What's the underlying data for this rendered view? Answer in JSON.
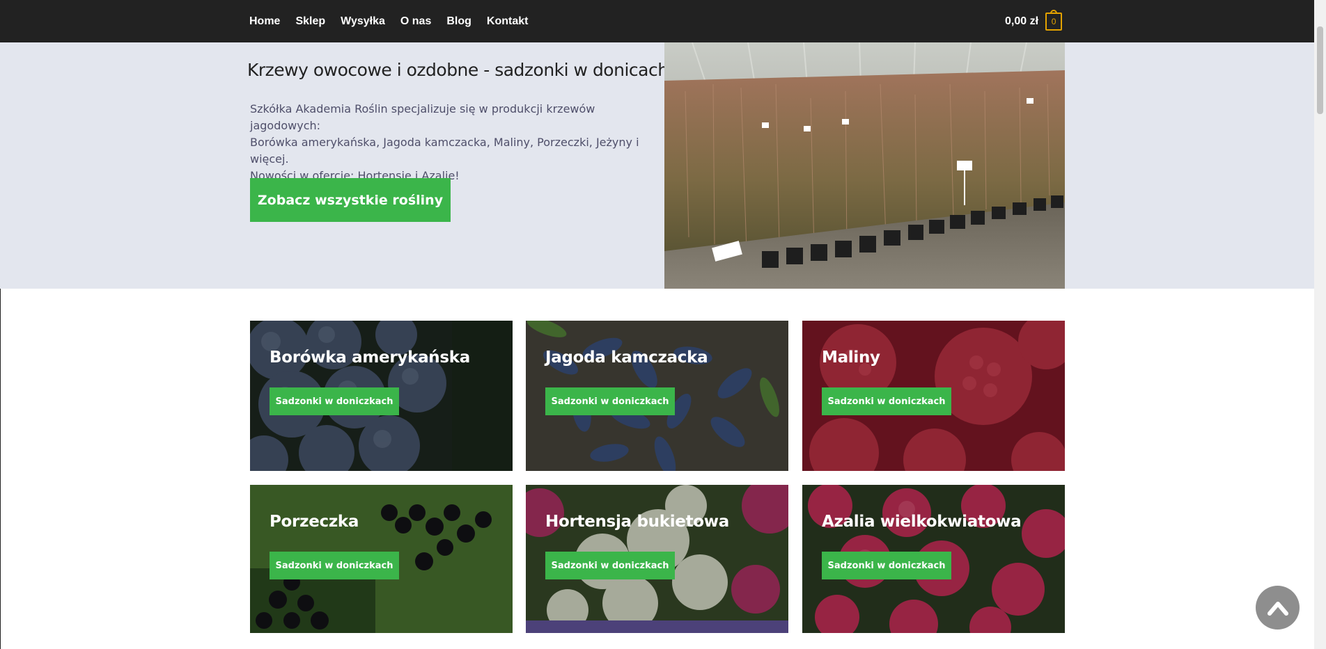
{
  "nav": {
    "items": [
      "Home",
      "Sklep",
      "Wysyłka",
      "O nas",
      "Blog",
      "Kontakt"
    ],
    "cart_total": "0,00 zł",
    "cart_count": "0"
  },
  "hero": {
    "title": "Krzewy owocowe i ozdobne - sadzonki w donicach",
    "text_lines": [
      "Szkółka Akademia Roślin specjalizuje się w produkcji krzewów jagodowych:",
      "Borówka amerykańska, Jagoda kamczacka, Maliny, Porzeczki, Jeżyny i więcej.",
      "Nowości w ofercie: Hortensje i Azalie!"
    ],
    "button": "Zobacz wszystkie rośliny"
  },
  "tiles": [
    {
      "title": "Borówka amerykańska",
      "button": "Sadzonki w doniczkach"
    },
    {
      "title": "Jagoda kamczacka",
      "button": "Sadzonki w doniczkach"
    },
    {
      "title": "Maliny",
      "button": "Sadzonki w doniczkach"
    },
    {
      "title": "Porzeczka",
      "button": "Sadzonki w doniczkach"
    },
    {
      "title": "Hortensja bukietowa",
      "button": "Sadzonki w doniczkach"
    },
    {
      "title": "Azalia wielkokwiatowa",
      "button": "Sadzonki w doniczkach"
    }
  ],
  "colors": {
    "topbar": "#222222",
    "hero_bg": "#e3e6ee",
    "accent_green": "#3bb54a",
    "cart_badge": "#e3a200"
  },
  "icons": [
    "cart-icon",
    "chevron-up-icon"
  ]
}
